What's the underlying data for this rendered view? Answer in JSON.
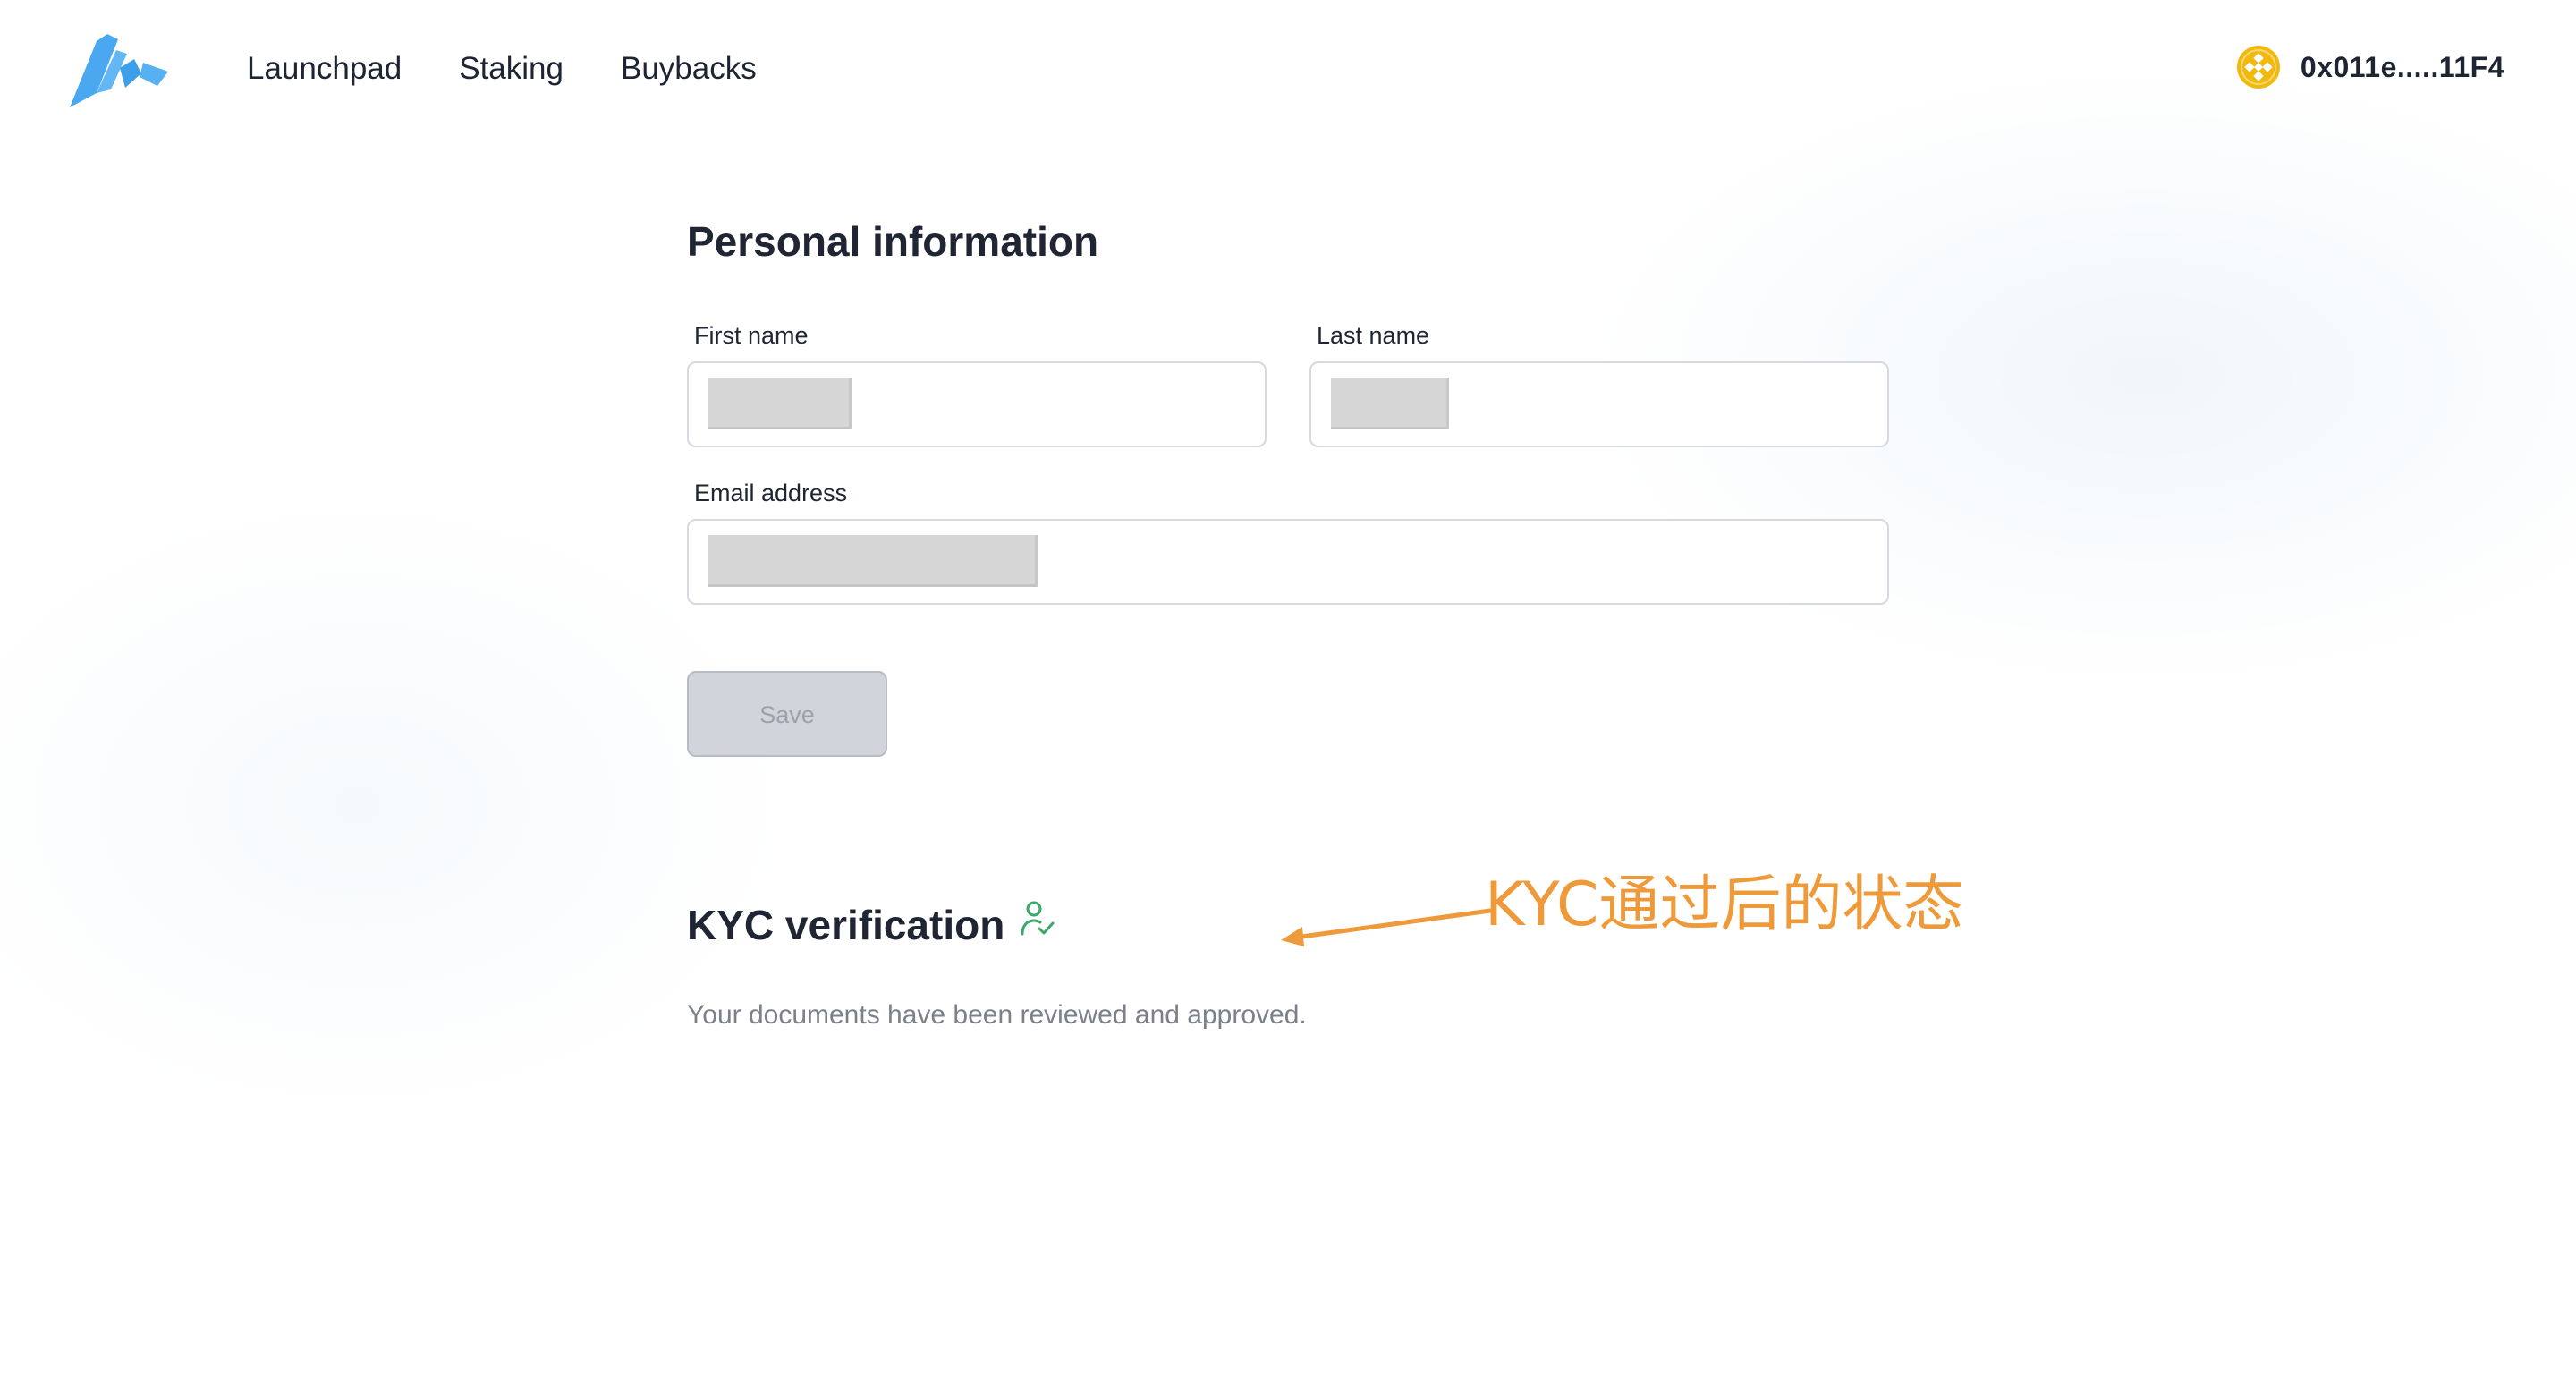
{
  "header": {
    "logo_icon": "brand-logo-icon",
    "nav": [
      {
        "label": "Launchpad"
      },
      {
        "label": "Staking"
      },
      {
        "label": "Buybacks"
      }
    ],
    "wallet": {
      "icon": "bnb-coin-icon",
      "address": "0x011e.....11F4"
    }
  },
  "personal_info": {
    "title": "Personal information",
    "first_name": {
      "label": "First name",
      "value_redacted": true
    },
    "last_name": {
      "label": "Last name",
      "value_redacted": true
    },
    "email": {
      "label": "Email address",
      "value_redacted": true
    },
    "save_label": "Save"
  },
  "kyc": {
    "title": "KYC verification",
    "status_icon": "user-check-icon",
    "status_text": "Your documents have been reviewed and approved."
  },
  "annotation": {
    "text": "KYC通过后的状态"
  },
  "colors": {
    "logo": "#4aa8f0",
    "wallet_coin": "#f0b90b",
    "kyc_icon": "#3aa86b",
    "annotation": "#ee9a3a",
    "button_disabled": "#d1d5db"
  }
}
